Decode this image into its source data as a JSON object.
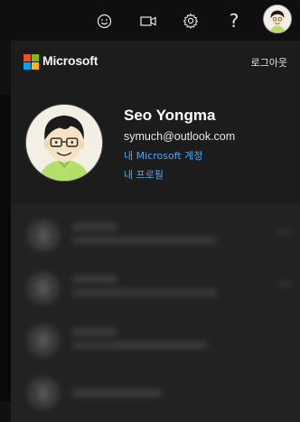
{
  "topbar": {
    "icons": [
      "smiley-icon",
      "video-icon",
      "gear-icon",
      "help-icon",
      "avatar"
    ],
    "help_glyph": "?"
  },
  "panel": {
    "brand": "Microsoft",
    "signout_label": "로그아웃",
    "user": {
      "name": "Seo Yongma",
      "email": "symuch@outlook.com"
    },
    "links": {
      "account": "내 Microsoft 계정",
      "profile": "내 프로필"
    }
  },
  "colors": {
    "link": "#4aa6ee",
    "ms_red": "#f25022",
    "ms_green": "#7fba00",
    "ms_blue": "#00a4ef",
    "ms_yellow": "#ffb900"
  }
}
